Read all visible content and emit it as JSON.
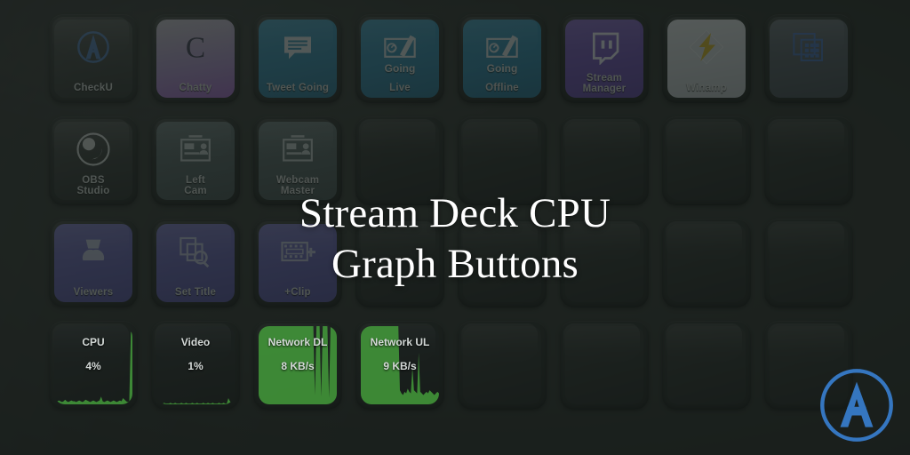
{
  "page": {
    "headline_line1": "Stream Deck CPU",
    "headline_line2": "Graph Buttons",
    "background_color": "#232825",
    "accent_color": "#3576c0"
  },
  "logo": {
    "name": "circle-a-logo",
    "letter": "A",
    "color": "#3576c0"
  },
  "deck": {
    "columns": 8,
    "rows": 4,
    "keys": [
      {
        "row": 1,
        "col": 1,
        "name": "checku",
        "label": "CheckU",
        "icon": "circle-a-icon",
        "style": "dark",
        "icon_color": "#3d6fae"
      },
      {
        "row": 1,
        "col": 2,
        "name": "chatty",
        "label": "Chatty",
        "icon": "letter-c-icon",
        "style": "chatty",
        "icon_color": "#2b2b44"
      },
      {
        "row": 1,
        "col": 3,
        "name": "tweet-going",
        "label": "Tweet Going",
        "icon": "speech-bubble-icon",
        "style": "teal",
        "icon_color": "#d6dee2"
      },
      {
        "row": 1,
        "col": 4,
        "name": "going-live",
        "label": "Live",
        "mid_label": "Going",
        "icon": "whiteboard-pen-icon",
        "style": "teal",
        "icon_color": "#d6dee2"
      },
      {
        "row": 1,
        "col": 5,
        "name": "going-offline",
        "label": "Offline",
        "mid_label": "Going",
        "icon": "whiteboard-pen-icon",
        "style": "teal",
        "icon_color": "#d6dee2"
      },
      {
        "row": 1,
        "col": 6,
        "name": "stream-manager",
        "label": "Stream",
        "label2": "Manager",
        "icon": "twitch-icon",
        "style": "purple",
        "icon_color": "#e8e9f4"
      },
      {
        "row": 1,
        "col": 7,
        "name": "winamp",
        "label": "Winamp",
        "icon": "lightning-bolt-icon",
        "style": "winamp",
        "icon_color": "#d8b520"
      },
      {
        "row": 1,
        "col": 8,
        "name": "window-grid",
        "label": "",
        "icon": "window-grid-icon",
        "style": "slate",
        "icon_color": "#3f6bb5"
      },
      {
        "row": 2,
        "col": 1,
        "name": "obs-studio",
        "label": "OBS",
        "label2": "Studio",
        "icon": "obs-icon",
        "style": "dark",
        "icon_color": "#cfd4d2"
      },
      {
        "row": 2,
        "col": 2,
        "name": "left-cam",
        "label": "Left",
        "label2": "Cam",
        "icon": "id-card-icon",
        "style": "webcam",
        "icon_color": "#b9c3c3"
      },
      {
        "row": 2,
        "col": 3,
        "name": "webcam-master",
        "label": "Webcam",
        "label2": "Master",
        "icon": "id-card-icon",
        "style": "webcam",
        "icon_color": "#b9c3c3"
      },
      {
        "row": 2,
        "col": 4,
        "name": "empty",
        "label": "",
        "icon": "",
        "style": "empty"
      },
      {
        "row": 2,
        "col": 5,
        "name": "empty",
        "label": "",
        "icon": "",
        "style": "empty"
      },
      {
        "row": 2,
        "col": 6,
        "name": "empty",
        "label": "",
        "icon": "",
        "style": "empty"
      },
      {
        "row": 2,
        "col": 7,
        "name": "empty",
        "label": "",
        "icon": "",
        "style": "empty"
      },
      {
        "row": 2,
        "col": 8,
        "name": "empty",
        "label": "",
        "icon": "",
        "style": "empty"
      },
      {
        "row": 3,
        "col": 1,
        "name": "viewers",
        "label": "Viewers",
        "icon": "person-icon",
        "style": "indigo",
        "icon_color": "#b6bbd6"
      },
      {
        "row": 3,
        "col": 2,
        "name": "set-title",
        "label": "Set Title",
        "icon": "copy-search-icon",
        "style": "indigo",
        "icon_color": "#b6bbd6"
      },
      {
        "row": 3,
        "col": 3,
        "name": "add-clip",
        "label": "+Clip",
        "icon": "film-strip-plus-icon",
        "style": "indigo",
        "icon_color": "#b6bbd6"
      },
      {
        "row": 3,
        "col": 4,
        "name": "empty",
        "label": "",
        "icon": "",
        "style": "empty"
      },
      {
        "row": 3,
        "col": 5,
        "name": "empty",
        "label": "",
        "icon": "",
        "style": "empty"
      },
      {
        "row": 3,
        "col": 6,
        "name": "empty",
        "label": "",
        "icon": "",
        "style": "empty"
      },
      {
        "row": 3,
        "col": 7,
        "name": "empty",
        "label": "",
        "icon": "",
        "style": "empty"
      },
      {
        "row": 3,
        "col": 8,
        "name": "empty",
        "label": "",
        "icon": "",
        "style": "empty"
      },
      {
        "row": 4,
        "col": 1,
        "name": "cpu-graph",
        "label": "CPU",
        "value": "4%",
        "style": "graph",
        "graph_color": "#46a03c",
        "graph_points": [
          4,
          3,
          4,
          5,
          4,
          3,
          4,
          6,
          4,
          3,
          4,
          5,
          4,
          4,
          3,
          4,
          5,
          4,
          3,
          4,
          6,
          5,
          4,
          3,
          4,
          5,
          4,
          3,
          4,
          5,
          10,
          4,
          3,
          4,
          5,
          4,
          3,
          4,
          5,
          4,
          3,
          4,
          5,
          4,
          8,
          6,
          4,
          3,
          4,
          92,
          95
        ]
      },
      {
        "row": 4,
        "col": 2,
        "name": "video-graph",
        "label": "Video",
        "value": "1%",
        "style": "graph",
        "graph_color": "#46a03c",
        "graph_points": [
          1,
          1,
          2,
          1,
          1,
          2,
          1,
          1,
          1,
          2,
          1,
          1,
          2,
          1,
          1,
          1,
          2,
          1,
          1,
          2,
          1,
          1,
          1,
          2,
          1,
          1,
          2,
          1,
          1,
          1,
          2,
          1,
          1,
          2,
          1,
          1,
          2,
          1,
          1,
          1,
          2,
          1,
          1,
          2,
          1,
          1,
          8,
          4,
          2,
          1,
          1
        ]
      },
      {
        "row": 4,
        "col": 3,
        "name": "network-dl-graph",
        "label": "Network DL",
        "value": "8 KB/s",
        "style": "graph",
        "graph_color": "#46a03c",
        "graph_points": [
          100,
          100,
          100,
          100,
          100,
          100,
          100,
          100,
          100,
          100,
          100,
          100,
          100,
          100,
          100,
          100,
          100,
          100,
          100,
          100,
          100,
          100,
          100,
          100,
          100,
          100,
          100,
          100,
          100,
          100,
          100,
          100,
          100,
          100,
          100,
          100,
          12,
          100,
          100,
          100,
          10,
          100,
          100,
          100,
          100,
          8,
          100,
          100,
          100,
          100,
          100
        ]
      },
      {
        "row": 4,
        "col": 4,
        "name": "network-ul-graph",
        "label": "Network UL",
        "value": "9 KB/s",
        "style": "graph",
        "graph_color": "#46a03c",
        "graph_points": [
          100,
          100,
          100,
          100,
          100,
          100,
          100,
          100,
          100,
          100,
          100,
          100,
          100,
          100,
          100,
          100,
          100,
          100,
          100,
          100,
          100,
          100,
          100,
          100,
          100,
          18,
          14,
          12,
          16,
          14,
          20,
          16,
          14,
          48,
          18,
          16,
          14,
          66,
          16,
          14,
          12,
          14,
          16,
          14,
          18,
          16,
          14,
          12,
          14,
          16,
          14
        ]
      },
      {
        "row": 4,
        "col": 5,
        "name": "empty",
        "label": "",
        "icon": "",
        "style": "empty"
      },
      {
        "row": 4,
        "col": 6,
        "name": "empty",
        "label": "",
        "icon": "",
        "style": "empty"
      },
      {
        "row": 4,
        "col": 7,
        "name": "empty",
        "label": "",
        "icon": "",
        "style": "empty"
      },
      {
        "row": 4,
        "col": 8,
        "name": "empty",
        "label": "",
        "icon": "",
        "style": "empty"
      }
    ]
  }
}
